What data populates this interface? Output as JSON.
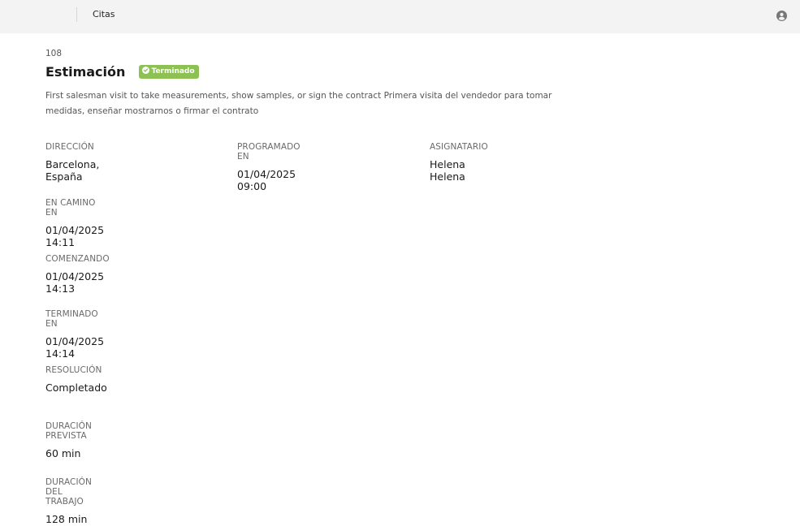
{
  "header": {
    "breadcrumb": "Citas",
    "user_icon": "user-circle-icon"
  },
  "record": {
    "id": "108",
    "title": "Estimación",
    "status": {
      "label": "Terminado",
      "color": "#8dc153",
      "icon": "check-circle-icon"
    },
    "description": "First salesman visit to take measurements, show samples, or sign the contract Primera visita del vendedor para tomar medidas, enseñar mostrarnos o firmar el contrato"
  },
  "fields": {
    "direccion": {
      "label": "DIRECCIÓN",
      "value": "Barcelona, España"
    },
    "programado": {
      "label": "PROGRAMADO EN",
      "value": "01/04/2025 09:00"
    },
    "asignatario": {
      "label": "ASIGNATARIO",
      "value": "Helena Helena"
    },
    "en_camino": {
      "label": "EN CAMINO EN",
      "value": "01/04/2025 14:11"
    },
    "comenzando": {
      "label": "COMENZANDO",
      "value": "01/04/2025 14:13"
    },
    "terminado": {
      "label": "TERMINADO EN",
      "value": "01/04/2025 14:14"
    },
    "resolucion": {
      "label": "RESOLUCIÓN",
      "value": "Completado"
    },
    "duracion_prevista": {
      "label": "DURACIÓN PREVISTA",
      "value": "60 min"
    },
    "duracion_trabajo": {
      "label": "DURACIÓN DEL TRABAJO",
      "value": "128 min"
    }
  }
}
